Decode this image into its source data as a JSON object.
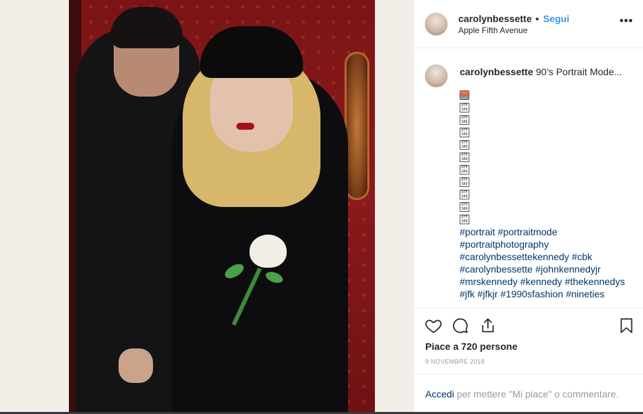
{
  "post": {
    "username": "carolynbessette",
    "separator": "•",
    "follow_label": "Segui",
    "location": "Apple Fifth Avenue",
    "more_label": "•••"
  },
  "caption": {
    "username": "carolynbessette",
    "text": "90’s Portrait Mode...",
    "emoji_top": "camera-with-flash",
    "emoji_glyph": "OTF SR9",
    "hashtags": "#portrait #portraitmode #portraitphotography #carolynbessettekennedy #cbk #carolynbessette #johnkennedyjr #mrskennedy #kennedy #thekennedys #jfk #jfkjr #1990sfashion #nineties"
  },
  "actions": {
    "likes": "Piace a 720 persone",
    "date": "9 NOVEMBRE 2018",
    "icons": [
      "heart-icon",
      "comment-bubble-icon",
      "share-icon",
      "bookmark-icon"
    ]
  },
  "login": {
    "link": "Accedi",
    "text": " per mettere \"Mi piace\" o commentare."
  },
  "colors": {
    "link_blue": "#3897f0",
    "hashtag": "#003569",
    "muted": "#999999",
    "text": "#262626"
  }
}
